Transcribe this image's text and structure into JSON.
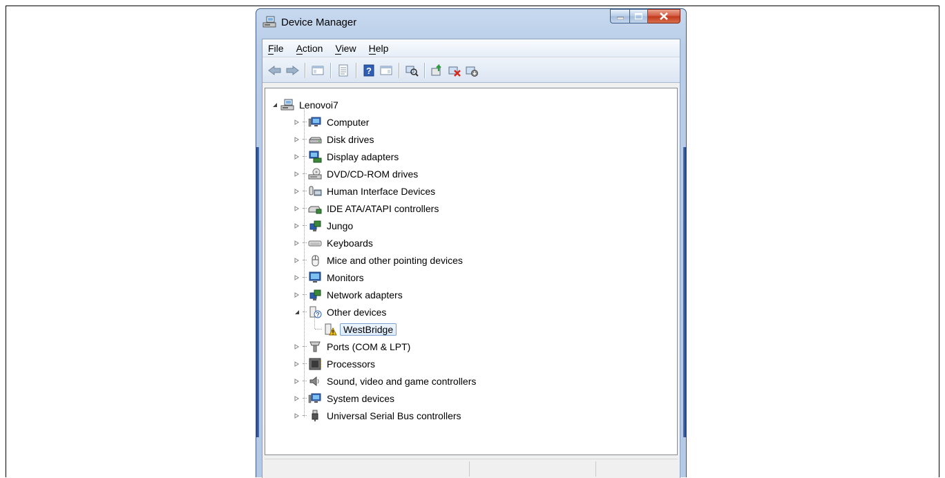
{
  "window": {
    "title": "Device Manager"
  },
  "menu": {
    "items": [
      {
        "label": "File",
        "underline": "F"
      },
      {
        "label": "Action",
        "underline": "A"
      },
      {
        "label": "View",
        "underline": "V"
      },
      {
        "label": "Help",
        "underline": "H"
      }
    ]
  },
  "toolbar": {
    "buttons": [
      "back-icon",
      "forward-icon",
      "show-hide-console-tree-icon",
      "properties-icon",
      "help-icon",
      "show-hide-action-pane-icon",
      "scan-hardware-icon",
      "update-driver-icon",
      "uninstall-icon",
      "disable-icon"
    ]
  },
  "tree": {
    "root": "Lenovoi7",
    "categories": [
      "Computer",
      "Disk drives",
      "Display adapters",
      "DVD/CD-ROM drives",
      "Human Interface Devices",
      "IDE ATA/ATAPI controllers",
      "Jungo",
      "Keyboards",
      "Mice and other pointing devices",
      "Monitors",
      "Network adapters",
      "Other devices",
      "Ports (COM & LPT)",
      "Processors",
      "Sound, video and game controllers",
      "System devices",
      "Universal Serial Bus controllers"
    ],
    "other_devices_child": "WestBridge"
  },
  "colors": {
    "title_bar": "#c7d9ef",
    "close_button": "#c2361a",
    "selection_border": "#7da2ce"
  }
}
